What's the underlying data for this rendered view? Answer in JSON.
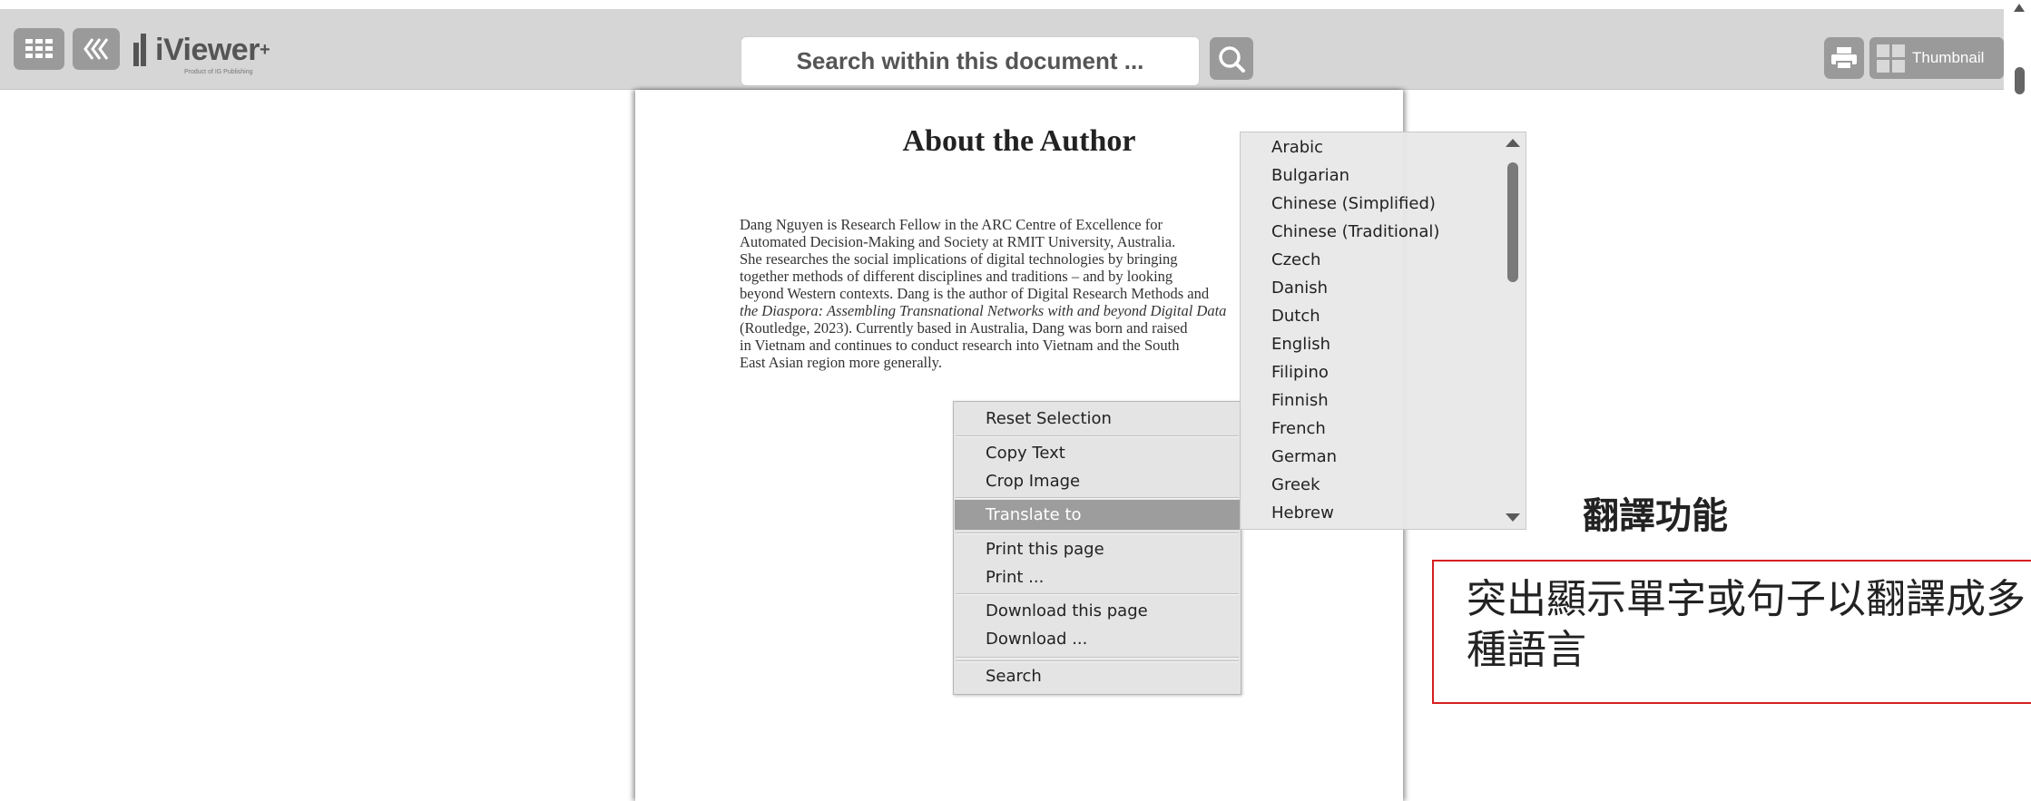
{
  "toolbar": {
    "grid_icon": "grid-icon",
    "back_icon": "double-chevron-left-icon",
    "logo_text": "iViewer",
    "logo_tagline": "Product of IG Publishing",
    "search_placeholder": "Search within this document ...",
    "search_icon": "search-icon",
    "print_icon": "printer-icon",
    "thumbnail_label": "Thumbnail"
  },
  "document": {
    "title": "About the Author",
    "lines": [
      "Dang Nguyen is Research Fellow in the ARC Centre of Excellence for",
      "Automated Decision-Making and Society at RMIT University, Australia.",
      "She researches the social implications of digital technologies by bringing",
      "together methods of different disciplines and traditions – and by looking",
      "beyond Western contexts. Dang is the author of Digital Research Methods and",
      "the Diaspora: Assembling Transnational Networks with and beyond Digital Data",
      "(Routledge, 2023). Currently based in Australia, Dang was born and raised",
      "in Vietnam and continues to conduct research into Vietnam and the South",
      "East Asian region more generally."
    ]
  },
  "context_menu": {
    "items": [
      "Reset Selection",
      "Copy Text",
      "Crop Image",
      "Translate to",
      "Print this page",
      "Print ...",
      "Download this page",
      "Download ...",
      "Search"
    ],
    "selected": "Translate to"
  },
  "languages": [
    "Arabic",
    "Bulgarian",
    "Chinese (Simplified)",
    "Chinese (Traditional)",
    "Czech",
    "Danish",
    "Dutch",
    "English",
    "Filipino",
    "Finnish",
    "French",
    "German",
    "Greek",
    "Hebrew"
  ],
  "annotation": {
    "title": "翻譯功能",
    "text_line1": "突出顯示單字或句子以翻譯成多",
    "text_line2": "種語言",
    "border_color": "#d61f1f"
  }
}
